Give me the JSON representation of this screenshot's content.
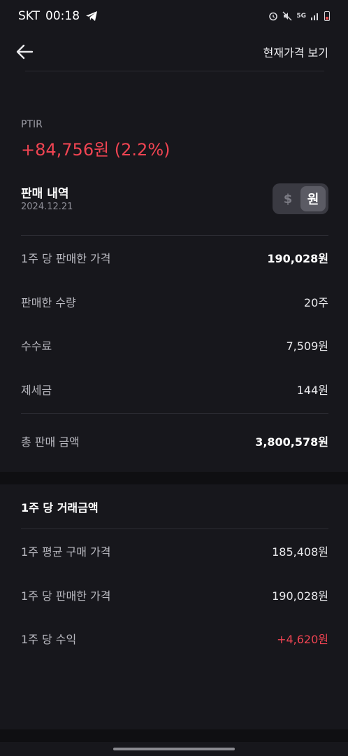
{
  "status_bar": {
    "carrier": "SKT",
    "time": "00:18",
    "network": "5G"
  },
  "nav": {
    "back_icon": "arrow-left-icon",
    "view_current_price": "현재가격 보기"
  },
  "summary": {
    "ticker": "PTIR",
    "profit": "+84,756원 (2.2%)",
    "profit_color": "#f04452"
  },
  "history": {
    "title": "판매 내역",
    "date": "2024.12.21",
    "currency_options": [
      "$",
      "원"
    ],
    "currency_selected": "원"
  },
  "sale_rows": [
    {
      "label": "1주 당 판매한 가격",
      "value": "190,028원"
    },
    {
      "label": "판매한 수량",
      "value": "20주"
    },
    {
      "label": "수수료",
      "value": "7,509원"
    },
    {
      "label": "제세금",
      "value": "144원"
    }
  ],
  "total": {
    "label": "총 판매 금액",
    "value": "3,800,578원"
  },
  "per_share": {
    "title": "1주 당 거래금액",
    "rows": [
      {
        "label": "1주 평균 구매 가격",
        "value": "185,408원"
      },
      {
        "label": "1주 당 판매한 가격",
        "value": "190,028원"
      },
      {
        "label": "1주 당 수익",
        "value": "+4,620원"
      }
    ]
  }
}
